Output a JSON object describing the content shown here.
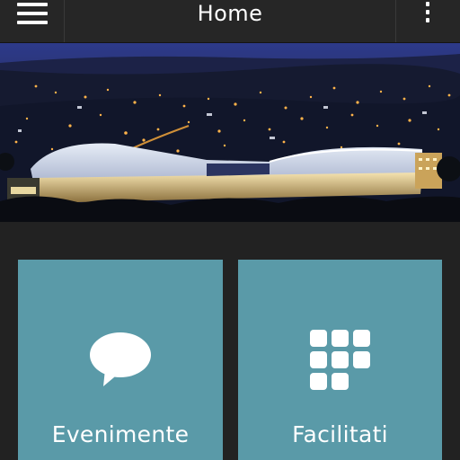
{
  "header": {
    "title": "Home",
    "menu_icon": "hamburger-menu-icon",
    "overflow_icon": "more-vertical-icon"
  },
  "hero": {
    "image": "night-stadium-photo"
  },
  "tiles": [
    {
      "label": "Evenimente",
      "icon": "speech-bubble-icon"
    },
    {
      "label": "Facilitati",
      "icon": "grid-icon"
    }
  ],
  "colors": {
    "background": "#222222",
    "toolbar": "#262626",
    "tile": "#5a9aa8",
    "text": "#ffffff"
  }
}
